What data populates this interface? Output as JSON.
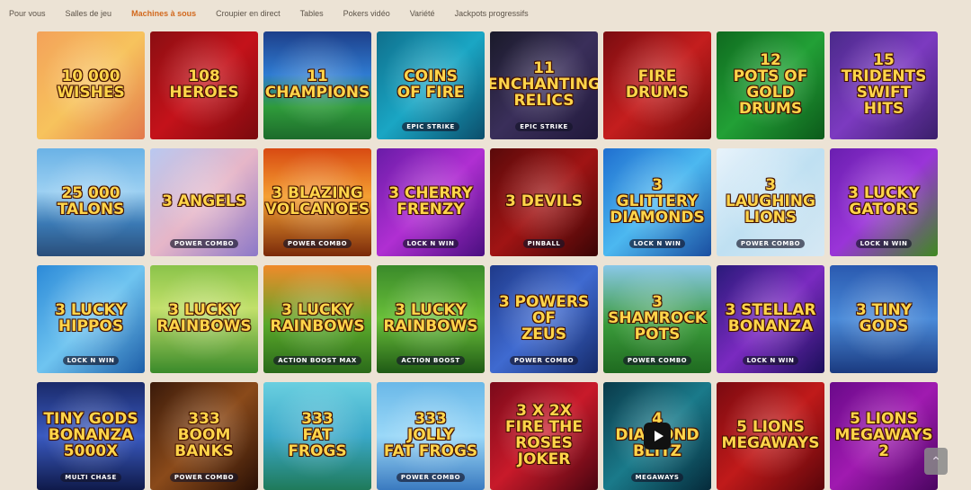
{
  "nav": {
    "items": [
      {
        "label": "Pour vous"
      },
      {
        "label": "Salles de jeu"
      },
      {
        "label": "Machines à sous",
        "active": true
      },
      {
        "label": "Croupier en direct"
      },
      {
        "label": "Tables"
      },
      {
        "label": "Pokers vidéo"
      },
      {
        "label": "Variété"
      },
      {
        "label": "Jackpots progressifs"
      }
    ]
  },
  "games": [
    {
      "title": "10 000\nWISHES",
      "sub": "",
      "bg": "linear-gradient(135deg,#f3a25a,#f7c35d 50%,#e2784b)"
    },
    {
      "title": "108\nHEROES",
      "sub": "",
      "bg": "linear-gradient(135deg,#8b0e12,#c4121a 50%,#7a0a0e)"
    },
    {
      "title": "11\nCHAMPIONS",
      "sub": "",
      "bg": "linear-gradient(180deg,#1d3f8a,#2f7bd1 40%,#2f9b3b 70%,#1d6b2b)"
    },
    {
      "title": "COINS\nOF FIRE",
      "sub": "EPIC STRIKE",
      "bg": "linear-gradient(135deg,#0f6f8c,#1aa6c4 50%,#0b4e6b)"
    },
    {
      "title": "11\nENCHANTING\nRELICS",
      "sub": "EPIC STRIKE",
      "bg": "linear-gradient(135deg,#1a1a2a,#3a2f5a 50%,#20183a)"
    },
    {
      "title": "FIRE DRUMS",
      "sub": "",
      "bg": "linear-gradient(135deg,#7a0c10,#c41e1e 50%,#6a0a0a)"
    },
    {
      "title": "12\nPOTS OF GOLD\nDRUMS",
      "sub": "",
      "bg": "linear-gradient(135deg,#0f6a1f,#22a036 50%,#0c5a1a)"
    },
    {
      "title": "15\nTRIDENTS\nSWIFT HITS",
      "sub": "",
      "bg": "linear-gradient(135deg,#4a2a8a,#7c3ac0 50%,#3a1f6a)"
    },
    {
      "title": "25 000\nTALONS",
      "sub": "",
      "bg": "linear-gradient(180deg,#6ab2e6,#9cd0f2 40%,#3a79b4 70%,#2a4e7a)"
    },
    {
      "title": "3 ANGELS",
      "sub": "POWER COMBO",
      "bg": "linear-gradient(135deg,#b9c8f0,#e6b6c8 50%,#8c78c8)"
    },
    {
      "title": "3 BLAZING\nVOLCANOES",
      "sub": "POWER COMBO",
      "bg": "linear-gradient(180deg,#d84a12,#f5a032 45%,#7a2a0a)"
    },
    {
      "title": "3 CHERRY\nFRENZY",
      "sub": "LOCK N WIN",
      "bg": "linear-gradient(135deg,#6a1ca8,#b02fd2 50%,#4a0f80)"
    },
    {
      "title": "3 DEVILS",
      "sub": "PINBALL",
      "bg": "linear-gradient(135deg,#5a0a0a,#a01414 50%,#3a0505)"
    },
    {
      "title": "3 GLITTERY\nDIAMONDS",
      "sub": "LOCK N WIN",
      "bg": "linear-gradient(135deg,#1f6fd0,#4cb8f0 50%,#1a4ea0)"
    },
    {
      "title": "3\nLAUGHING\nLIONS",
      "sub": "POWER COMBO",
      "bg": "linear-gradient(135deg,#e8f3fb,#bfe0f2 50%,#d6e8f3)"
    },
    {
      "title": "3 LUCKY\nGATORS",
      "sub": "LOCK N WIN",
      "bg": "linear-gradient(135deg,#6a1fb0,#9a34d8 50%,#3f8a1f)"
    },
    {
      "title": "3 LUCKY\nHIPPOS",
      "sub": "LOCK N WIN",
      "bg": "linear-gradient(135deg,#2c8ad8,#6fc4f0 50%,#1d5ea8)"
    },
    {
      "title": "3 LUCKY\nRAINBOWS",
      "sub": "",
      "bg": "linear-gradient(180deg,#8ac34a,#c2e06a 40%,#3a8a2a)"
    },
    {
      "title": "3 LUCKY\nRAINBOWS",
      "sub": "ACTION BOOST MAX",
      "bg": "linear-gradient(180deg,#f08a2a,#5aa82a 55%,#2a6a1a)"
    },
    {
      "title": "3 LUCKY\nRAINBOWS",
      "sub": "ACTION BOOST",
      "bg": "linear-gradient(180deg,#3a8a2a,#6ac03a 50%,#1f5a15)"
    },
    {
      "title": "3 POWERS\nOF\nZEUS",
      "sub": "POWER COMBO",
      "bg": "linear-gradient(135deg,#1f3a8a,#3f6ad0 50%,#152a6a)"
    },
    {
      "title": "3 SHAMROCK\nPOTS",
      "sub": "POWER COMBO",
      "bg": "linear-gradient(180deg,#8ac8e8,#3a9a3a 55%,#1f6a20)"
    },
    {
      "title": "3 STELLAR\nBONANZA",
      "sub": "LOCK N WIN",
      "bg": "linear-gradient(135deg,#2a1a7a,#7a2ac0 50%,#1a0f5a)"
    },
    {
      "title": "3 TINY\nGODS",
      "sub": "",
      "bg": "linear-gradient(180deg,#2a5ab0,#4a8ad8 50%,#1a3a80)"
    },
    {
      "title": "TINY GODS\nBONANZA\n5000X",
      "sub": "MULTI CHASE",
      "bg": "linear-gradient(180deg,#1a2a6a,#3a5ac0 50%,#0f1a4a)"
    },
    {
      "title": "333\nBOOM\nBANKS",
      "sub": "POWER COMBO",
      "bg": "linear-gradient(135deg,#3a1a0a,#8a4a1a 50%,#2a1005)"
    },
    {
      "title": "333\nFAT\nFROGS",
      "sub": "",
      "bg": "linear-gradient(180deg,#6acfe0,#3aa8c8 50%,#1f7a5a)"
    },
    {
      "title": "333\nJOLLY\nFAT FROGS",
      "sub": "POWER COMBO",
      "bg": "linear-gradient(180deg,#6ab8e8,#9ad8f8 50%,#3a7ac0)"
    },
    {
      "title": "3 X 2X\nFIRE THE ROSES\nJOKER",
      "sub": "",
      "bg": "linear-gradient(135deg,#7a0a1a,#c81a2a 50%,#4a0510)"
    },
    {
      "title": "4\nDIAMOND\nBLITZ",
      "sub": "MEGAWAYS",
      "bg": "linear-gradient(135deg,#0a3a4a,#1a7a8a 50%,#052a3a)"
    },
    {
      "title": "5 LIONS\nMEGAWAYS",
      "sub": "",
      "bg": "linear-gradient(135deg,#7a0a10,#c01a1a 50%,#5a050a)"
    },
    {
      "title": "5 LIONS\nMEGAWAYS\n2",
      "sub": "",
      "bg": "linear-gradient(135deg,#6a0a8a,#a01ab0 50%,#4a0560)"
    }
  ],
  "media": {
    "play_icon": "play-icon"
  },
  "ui": {
    "scroll_top_icon": "chevron-up-icon",
    "scroll_top_glyph": "⌃"
  }
}
